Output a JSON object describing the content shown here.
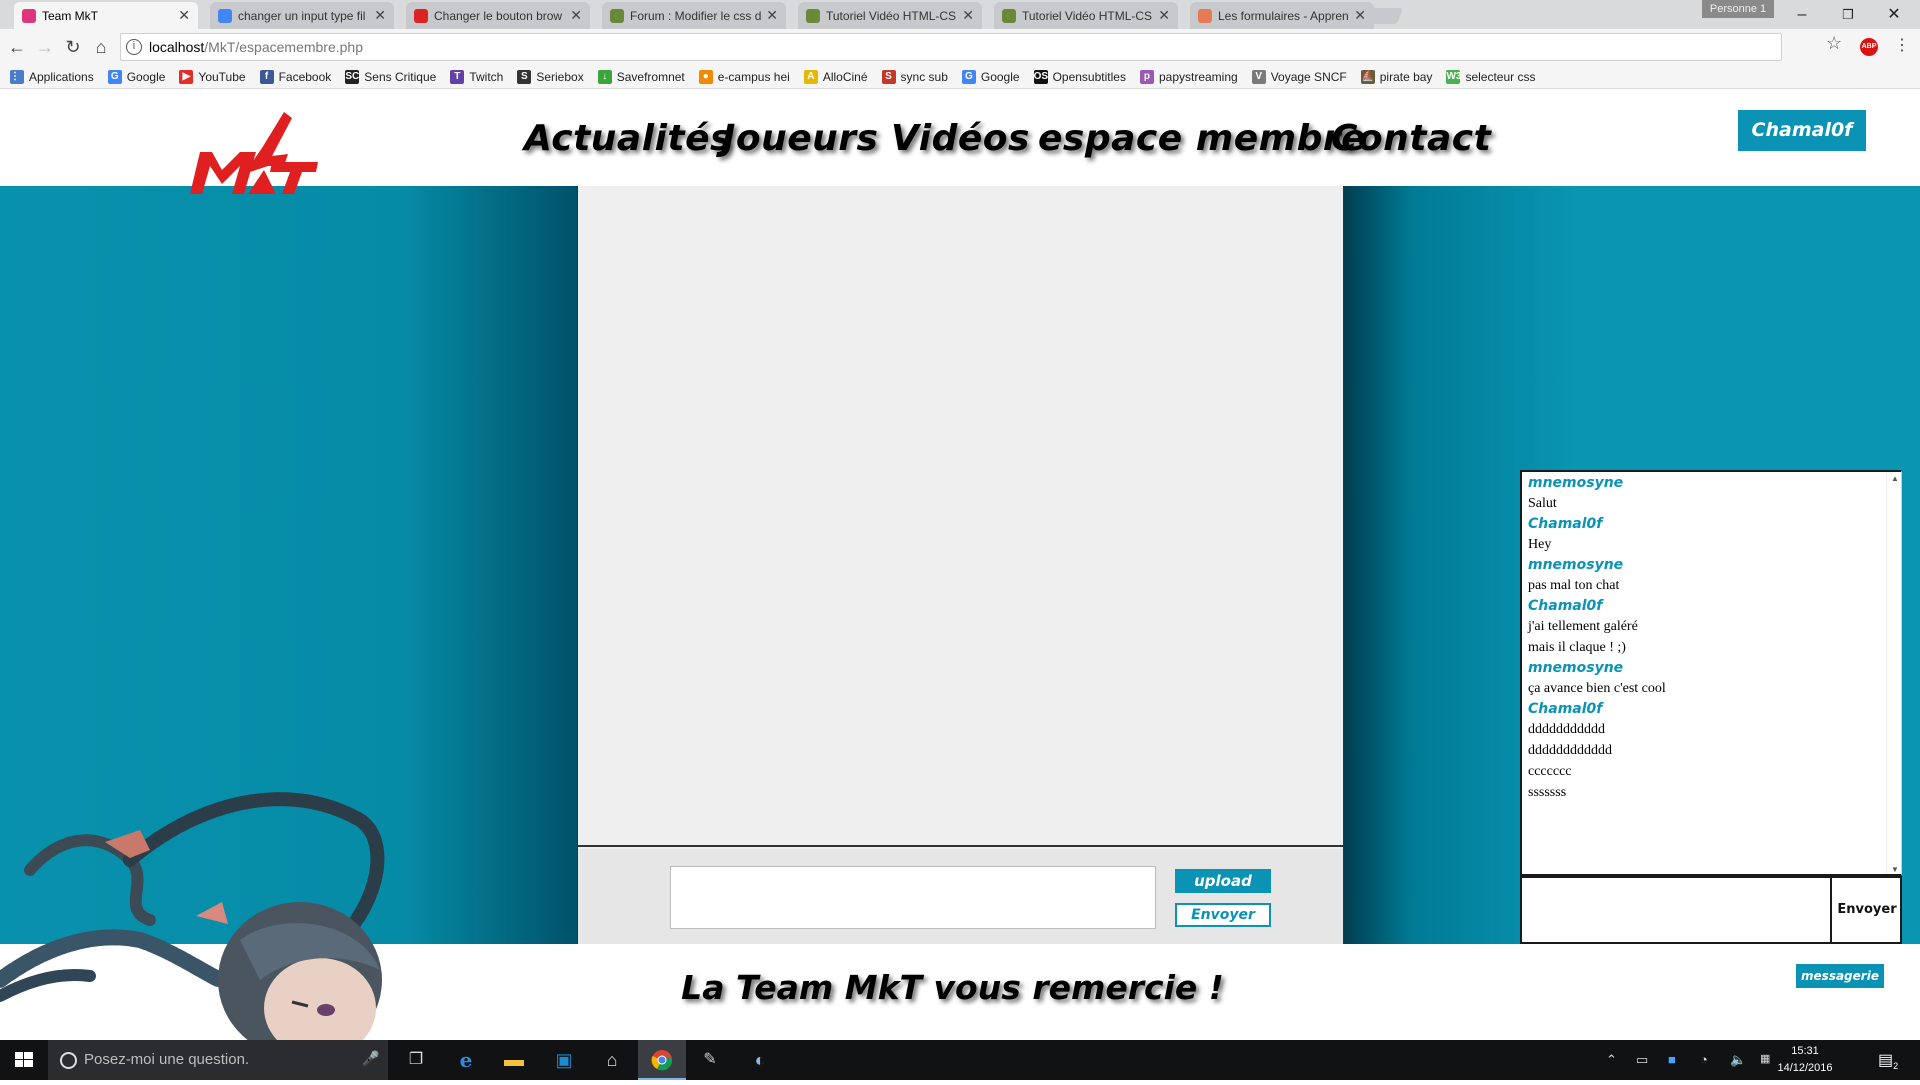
{
  "browser": {
    "tabs": [
      {
        "label": "Team MkT",
        "color": "#e0357d"
      },
      {
        "label": "changer un input type fil",
        "color": "#4285f4"
      },
      {
        "label": "Changer le bouton brow",
        "color": "#d22"
      },
      {
        "label": "Forum : Modifier le css d",
        "color": "#6a8a3a"
      },
      {
        "label": "Tutoriel Vidéo HTML-CS",
        "color": "#6a8a3a"
      },
      {
        "label": "Tutoriel Vidéo HTML-CS",
        "color": "#6a8a3a"
      },
      {
        "label": "Les formulaires - Appren",
        "color": "#e57a55"
      }
    ],
    "profile": "Personne 1",
    "url_host": "localhost",
    "url_path": "/MkT/espacemembre.php",
    "bookmarks": [
      {
        "label": "Applications",
        "icon": "apps-grid-icon",
        "color": "#4a7cc9",
        "glyph": "⋮⋮"
      },
      {
        "label": "Google",
        "icon": "google-icon",
        "color": "#4285f4",
        "glyph": "G"
      },
      {
        "label": "YouTube",
        "icon": "youtube-icon",
        "color": "#e52d27",
        "glyph": "▶"
      },
      {
        "label": "Facebook",
        "icon": "facebook-icon",
        "color": "#3b5998",
        "glyph": "f"
      },
      {
        "label": "Sens Critique",
        "icon": "senscritique-icon",
        "color": "#222",
        "glyph": "SC"
      },
      {
        "label": "Twitch",
        "icon": "twitch-icon",
        "color": "#6441a5",
        "glyph": "T"
      },
      {
        "label": "Seriebox",
        "icon": "seriebox-icon",
        "color": "#333",
        "glyph": "S"
      },
      {
        "label": "Savefromnet",
        "icon": "savefrom-icon",
        "color": "#3aa63a",
        "glyph": "↓"
      },
      {
        "label": "e-campus hei",
        "icon": "ecampus-icon",
        "color": "#f08a00",
        "glyph": "●"
      },
      {
        "label": "AlloCiné",
        "icon": "allocine-icon",
        "color": "#e6b800",
        "glyph": "A"
      },
      {
        "label": "sync sub",
        "icon": "syncsub-icon",
        "color": "#c0392b",
        "glyph": "S"
      },
      {
        "label": "Google",
        "icon": "google-icon",
        "color": "#4285f4",
        "glyph": "G"
      },
      {
        "label": "Opensubtitles",
        "icon": "opensubtitles-icon",
        "color": "#111",
        "glyph": "OS"
      },
      {
        "label": "papystreaming",
        "icon": "papystreaming-icon",
        "color": "#9b59b6",
        "glyph": "p"
      },
      {
        "label": "Voyage SNCF",
        "icon": "sncf-icon",
        "color": "#7a7a7a",
        "glyph": "V"
      },
      {
        "label": "pirate bay",
        "icon": "piratebay-icon",
        "color": "#6b5b3a",
        "glyph": "⛵"
      },
      {
        "label": "selecteur css",
        "icon": "w3schools-icon",
        "color": "#4caf50",
        "glyph": "W3"
      }
    ]
  },
  "site": {
    "logo_text": "MKT",
    "nav": [
      "Actualités",
      "Joueurs",
      "Vidéos",
      "espace membre",
      "Contact"
    ],
    "user": "Chamal0f",
    "accent": "#0a93b5",
    "upload_label": "upload",
    "send_label": "Envoyer",
    "footer": "La Team MkT vous remercie !",
    "messagerie_label": "messagerie"
  },
  "chat": {
    "messages": [
      {
        "author": "mnemosyne",
        "lines": [
          "Salut"
        ]
      },
      {
        "author": "Chamal0f",
        "lines": [
          "Hey"
        ]
      },
      {
        "author": "mnemosyne",
        "lines": [
          "pas mal ton chat"
        ]
      },
      {
        "author": "Chamal0f",
        "lines": [
          "j'ai tellement galéré",
          "mais il claque ! ;)"
        ]
      },
      {
        "author": "mnemosyne",
        "lines": [
          "ça avance bien c'est cool"
        ]
      },
      {
        "author": "Chamal0f",
        "lines": [
          "ddddddddddd",
          "dddddddddddd",
          "ccccccc",
          "sssssss"
        ]
      }
    ],
    "send_label": "Envoyer"
  },
  "taskbar": {
    "search_placeholder": "Posez-moi une question.",
    "time": "15:31",
    "date": "14/12/2016",
    "notifications": "2"
  }
}
